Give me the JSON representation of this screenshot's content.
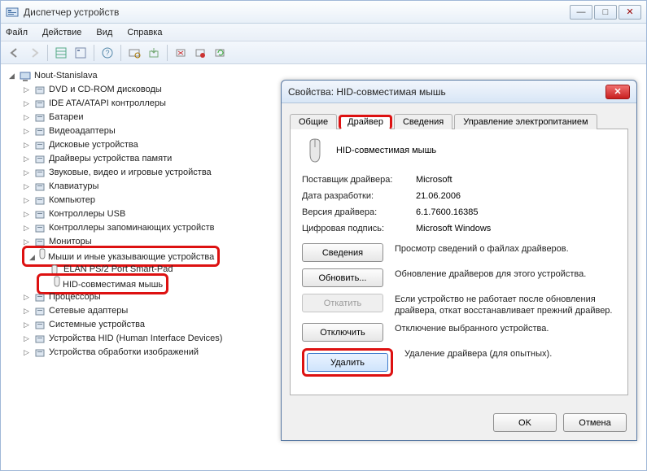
{
  "window": {
    "title": "Диспетчер устройств",
    "minimize": "—",
    "maximize": "□",
    "close": "✕"
  },
  "menu": {
    "file": "Файл",
    "action": "Действие",
    "view": "Вид",
    "help": "Справка"
  },
  "tree": {
    "root": "Nout-Stanislava",
    "items": [
      "DVD и CD-ROM дисководы",
      "IDE ATA/ATAPI контроллеры",
      "Батареи",
      "Видеоадаптеры",
      "Дисковые устройства",
      "Драйверы устройства памяти",
      "Звуковые, видео и игровые устройства",
      "Клавиатуры",
      "Компьютер",
      "Контроллеры USB",
      "Контроллеры запоминающих устройств",
      "Мониторы"
    ],
    "mice_group": "Мыши и иные указывающие устройства",
    "mice_children": [
      "ELAN PS/2 Port Smart-Pad",
      "HID-совместимая мышь"
    ],
    "items_after": [
      "Процессоры",
      "Сетевые адаптеры",
      "Системные устройства",
      "Устройства HID (Human Interface Devices)",
      "Устройства обработки изображений"
    ]
  },
  "dialog": {
    "title": "Свойства: HID-совместимая мышь",
    "tabs": {
      "general": "Общие",
      "driver": "Драйвер",
      "details": "Сведения",
      "power": "Управление электропитанием"
    },
    "device_name": "HID-совместимая мышь",
    "info": {
      "provider_label": "Поставщик драйвера:",
      "provider": "Microsoft",
      "date_label": "Дата разработки:",
      "date": "21.06.2006",
      "version_label": "Версия драйвера:",
      "version": "6.1.7600.16385",
      "signature_label": "Цифровая подпись:",
      "signature": "Microsoft Windows"
    },
    "buttons": {
      "details": "Сведения",
      "details_desc": "Просмотр сведений о файлах драйверов.",
      "update": "Обновить...",
      "update_desc": "Обновление драйверов для этого устройства.",
      "rollback": "Откатить",
      "rollback_desc": "Если устройство не работает после обновления драйвера, откат восстанавливает прежний драйвер.",
      "disable": "Отключить",
      "disable_desc": "Отключение выбранного устройства.",
      "uninstall": "Удалить",
      "uninstall_desc": "Удаление драйвера (для опытных)."
    },
    "ok": "OK",
    "cancel": "Отмена"
  }
}
